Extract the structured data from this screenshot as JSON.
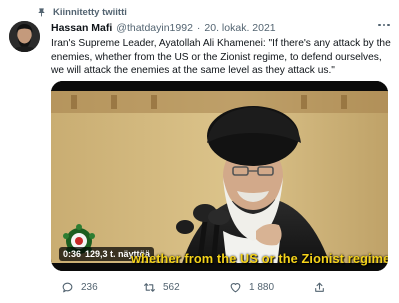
{
  "pinned": {
    "label": "Kiinnitetty twiitti"
  },
  "tweet": {
    "name": "Hassan Mafi",
    "handle": "@thatdayin1992",
    "separator": "·",
    "date": "20. lokak. 2021",
    "text": "Iran's Supreme Leader, Ayatollah Ali Khamenei: \"If there's any attack by the enemies, whether from the US or the Zionist regime, to defend ourselves, we will attack the enemies at the same level as they attack us.\""
  },
  "video": {
    "time": "0:36",
    "views": "129,3 t. näyttöä",
    "subtitle": "whether from the US or the Zionist regime"
  },
  "actions": {
    "replies": "236",
    "retweets": "562",
    "likes": "1 880"
  },
  "colors": {
    "text": "#0f1419",
    "secondary": "#536471",
    "subtitle": "#f5d31a"
  },
  "icons": [
    "pin-icon",
    "more-icon",
    "reply-icon",
    "retweet-icon",
    "like-icon",
    "share-icon"
  ]
}
